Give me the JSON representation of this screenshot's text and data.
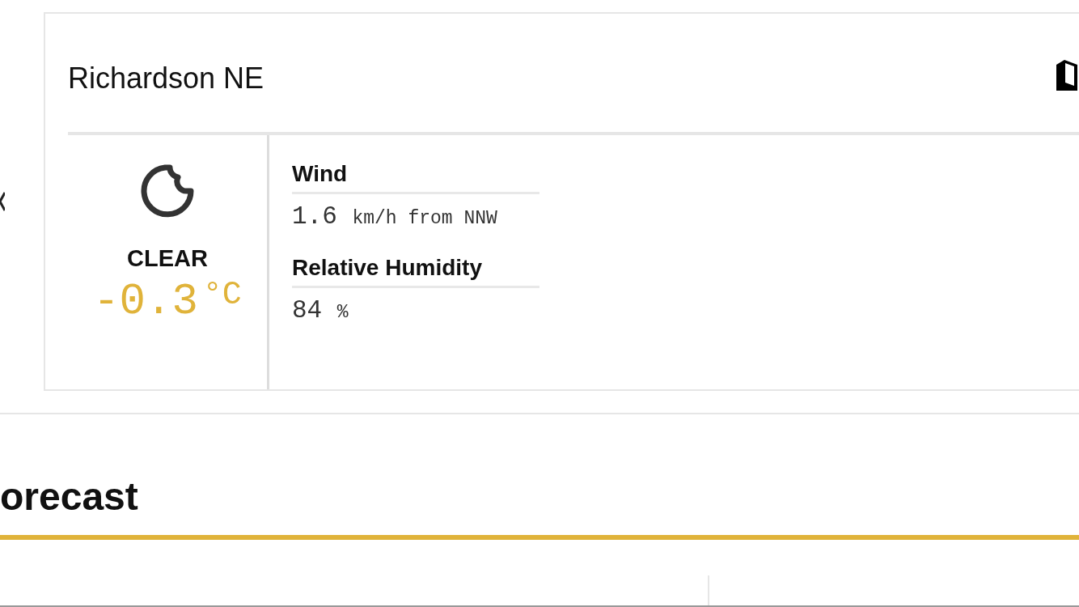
{
  "station": {
    "name": "Richardson NE"
  },
  "current": {
    "condition": "CLEAR",
    "temperature": {
      "value": "-0.3",
      "unit": "°C"
    },
    "details": [
      {
        "label": "Wind",
        "value": "1.6",
        "unit": "km/h from NNW"
      },
      {
        "label": "Relative Humidity",
        "value": "84",
        "unit": "%"
      }
    ]
  },
  "section": {
    "title": "orecast"
  }
}
